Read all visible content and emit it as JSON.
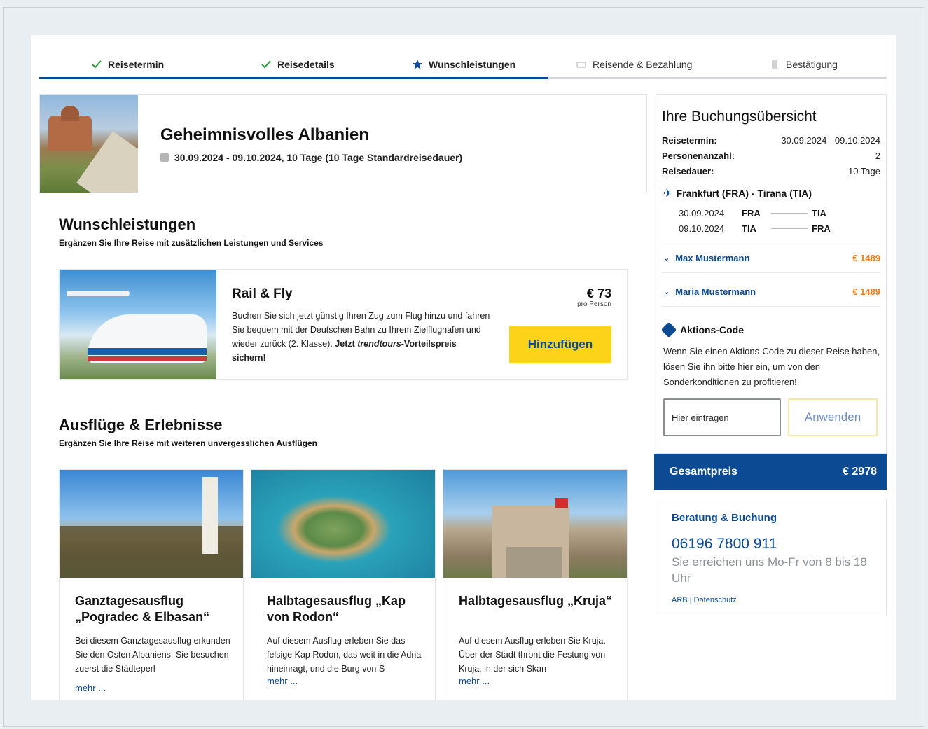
{
  "steps": [
    {
      "label": "Reisetermin",
      "state": "done"
    },
    {
      "label": "Reisedetails",
      "state": "done"
    },
    {
      "label": "Wunschleistungen",
      "state": "active"
    },
    {
      "label": "Reisende & Bezahlung",
      "state": "pending"
    },
    {
      "label": "Bestätigung",
      "state": "pending"
    }
  ],
  "trip": {
    "title": "Geheimnisvolles Albanien",
    "dates": "30.09.2024 - 09.10.2024, 10 Tage (10 Tage Standardreisedauer)"
  },
  "wunsch": {
    "title": "Wunschleistungen",
    "subtitle": "Ergänzen Sie Ihre Reise mit zusätzlichen Leistungen und Services"
  },
  "rail": {
    "title": "Rail & Fly",
    "text_plain": "Buchen Sie sich jetzt günstig Ihren Zug zum Flug hinzu und fahren Sie bequem mit der Deutschen Bahn zu Ihrem Zielflughafen und wieder zurück (2. Klasse).",
    "text_bold": "Jetzt",
    "text_brand": "trendtours",
    "text_bold_end": "-Vorteilspreis sichern!",
    "price": "€ 73",
    "price_unit": "pro Person",
    "add_label": "Hinzufügen"
  },
  "excursions_section": {
    "title": "Ausflüge & Erlebnisse",
    "subtitle": "Ergänzen Sie Ihre Reise mit weiteren unvergesslichen Ausflügen"
  },
  "excursions": [
    {
      "title": "Ganztagesausflug „Pogradec & Elbasan“",
      "text": "Bei diesem Ganztagesausflug erkunden Sie den Osten Albaniens. Sie besuchen zuerst die Städteperl",
      "more": "mehr ..."
    },
    {
      "title": "Halbtagesausflug „Kap von Rodon“",
      "text": "Auf diesem Ausflug erleben Sie das felsige Kap Rodon, das weit in die Adria hineinragt, und die Burg von S",
      "more": "mehr ..."
    },
    {
      "title": "Halbtagesausflug „Kruja“",
      "text": "Auf diesem Ausflug erleben Sie Kruja. Über der Stadt thront die Festung von Kruja, in der sich Skan",
      "more": "mehr ..."
    }
  ],
  "summary": {
    "title": "Ihre Buchungsübersicht",
    "rows": [
      {
        "key": "Reisetermin:",
        "value": "30.09.2024 - 09.10.2024"
      },
      {
        "key": "Personenanzahl:",
        "value": "2"
      },
      {
        "key": "Reisedauer:",
        "value": "10 Tage"
      }
    ],
    "flight_title": "Frankfurt (FRA) - Tirana (TIA)",
    "flights": [
      {
        "date": "30.09.2024",
        "from": "FRA",
        "to": "TIA"
      },
      {
        "date": "09.10.2024",
        "from": "TIA",
        "to": "FRA"
      }
    ],
    "travelers": [
      {
        "name": "Max Mustermann",
        "price": "€ 1489"
      },
      {
        "name": "Maria Mustermann",
        "price": "€ 1489"
      }
    ],
    "promo_title": "Aktions-Code",
    "promo_text": "Wenn Sie einen Aktions-Code zu dieser Reise haben, lösen Sie ihn bitte hier ein, um von den Sonderkonditionen zu profitieren!",
    "promo_placeholder": "Hier eintragen",
    "apply_label": "Anwenden"
  },
  "total": {
    "label": "Gesamtpreis",
    "value": "€ 2978"
  },
  "contact": {
    "title": "Beratung & Buchung",
    "phone": "06196 7800 911",
    "hours": "Sie erreichen uns Mo-Fr von 8 bis 18 Uhr",
    "link_arb": "ARB",
    "separator": "|",
    "link_privacy": "Datenschutz"
  },
  "colors": {
    "brand": "#0c4a94",
    "accent": "#fcd319",
    "price": "#f07d1c"
  }
}
